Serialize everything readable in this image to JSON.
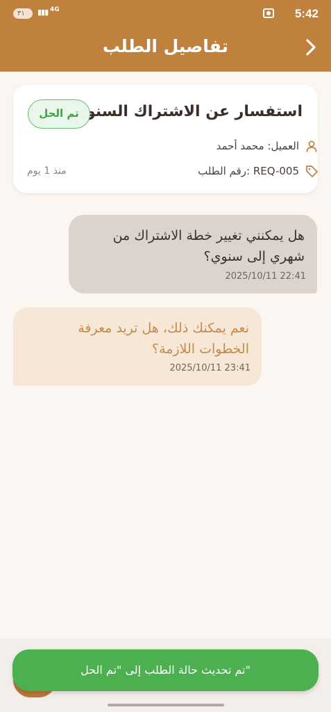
{
  "status_bar": {
    "time": "5:42",
    "battery": "٣١",
    "network": "4G"
  },
  "header": {
    "title": "تفاصيل الطلب",
    "back_icon": "chevron-right-icon"
  },
  "request": {
    "title": "استفسار عن الاشتراك السنوي",
    "status_badge": "تم الحل",
    "customer": "العميل: محمد أحمد",
    "request_number": "رقم الطلب: REQ-005",
    "age": "منذ 1 يوم"
  },
  "messages": [
    {
      "line1": "هل يمكنني تغيير خطة الاشتراك من",
      "line2": "شهري إلى سنوي؟",
      "timestamp": "2025/10/11 22:41"
    },
    {
      "line1": "نعم يمكنك ذلك، هل تريد معرفة",
      "line2": "الخطوات اللازمة؟",
      "timestamp": "2025/10/11 23:41"
    }
  ],
  "toast": {
    "text": "تم تحديث حالة الطلب إلى \"تم الحل\""
  },
  "colors": {
    "primary": "#c0813c",
    "success": "#4caf50",
    "background": "#fbf6f1"
  }
}
